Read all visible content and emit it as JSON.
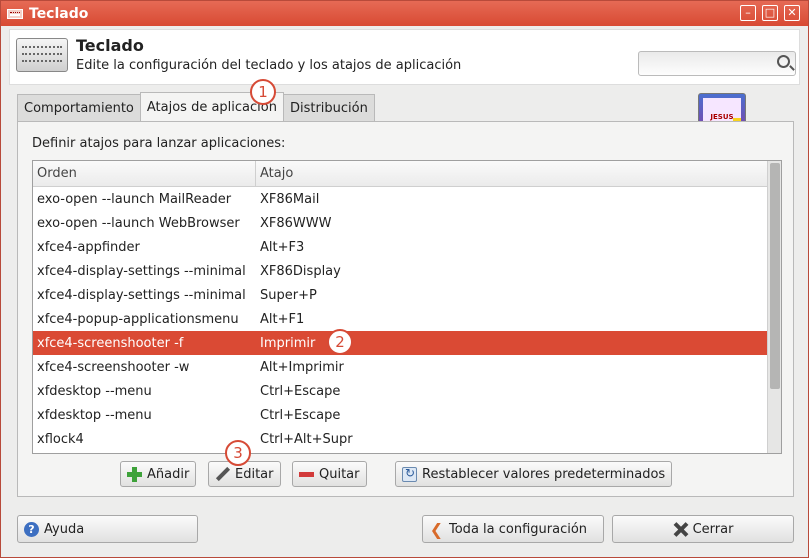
{
  "window": {
    "title": "Teclado"
  },
  "header": {
    "title": "Teclado",
    "subtitle": "Edite la configuración del teclado y los atajos de aplicación",
    "search_value": ""
  },
  "tabs": [
    {
      "label": "Comportamiento",
      "active": false
    },
    {
      "label": "Atajos de aplicación",
      "active": true
    },
    {
      "label": "Distribución",
      "active": false
    }
  ],
  "panel": {
    "label": "Definir atajos para lanzar aplicaciones:",
    "columns": [
      "Orden",
      "Atajo"
    ],
    "rows": [
      {
        "command": "exo-open --launch MailReader",
        "shortcut": "XF86Mail"
      },
      {
        "command": "exo-open --launch WebBrowser",
        "shortcut": "XF86WWW"
      },
      {
        "command": "xfce4-appfinder",
        "shortcut": "Alt+F3"
      },
      {
        "command": "xfce4-display-settings --minimal",
        "shortcut": "XF86Display"
      },
      {
        "command": "xfce4-display-settings --minimal",
        "shortcut": "Super+P"
      },
      {
        "command": "xfce4-popup-applicationsmenu",
        "shortcut": "Alt+F1"
      },
      {
        "command": "xfce4-screenshooter -f",
        "shortcut": "Imprimir",
        "selected": true
      },
      {
        "command": "xfce4-screenshooter -w",
        "shortcut": "Alt+Imprimir"
      },
      {
        "command": "xfdesktop --menu",
        "shortcut": "Ctrl+Escape"
      },
      {
        "command": "xfdesktop --menu",
        "shortcut": "Ctrl+Escape"
      },
      {
        "command": "xflock4",
        "shortcut": "Ctrl+Alt+Supr"
      }
    ],
    "buttons": {
      "add": "Añadir",
      "edit": "Editar",
      "remove": "Quitar",
      "reset": "Restablecer valores predeterminados"
    }
  },
  "footer": {
    "help": "Ayuda",
    "all_settings": "Toda la configuración",
    "close": "Cerrar"
  },
  "annotations": [
    "1",
    "2",
    "3"
  ],
  "logo_text": "JESUS",
  "colors": {
    "titlebar": "#d84a33",
    "selection": "#da4a34",
    "badge": "#d64a36"
  }
}
